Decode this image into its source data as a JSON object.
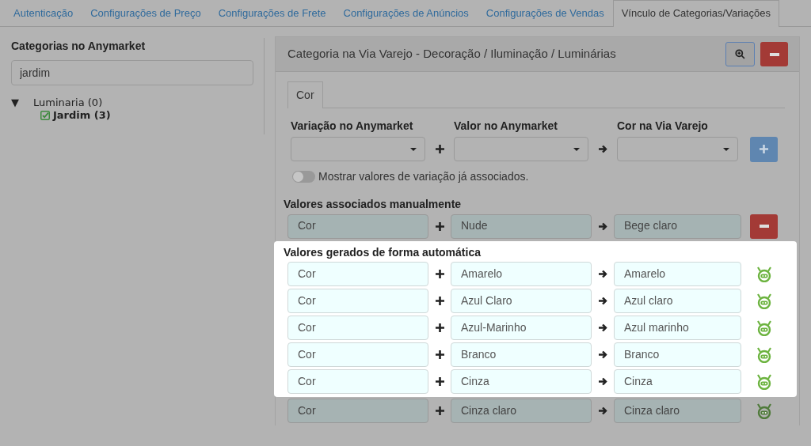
{
  "tabs": [
    {
      "label": "Autenticação",
      "selected": false
    },
    {
      "label": "Configurações de Preço",
      "selected": false
    },
    {
      "label": "Configurações de Frete",
      "selected": false
    },
    {
      "label": "Configurações de Anúncios",
      "selected": false
    },
    {
      "label": "Configurações de Vendas",
      "selected": false
    },
    {
      "label": "Vínculo de Categorias/Variações",
      "selected": true
    }
  ],
  "sidebar": {
    "title": "Categorias no Anymarket",
    "search": {
      "value": "jardim"
    },
    "tree": [
      {
        "toggle": "▼",
        "label": "Luminaria (0)",
        "expanded": true,
        "children": [
          {
            "label": "Jardim (3)",
            "checked": true
          }
        ]
      }
    ]
  },
  "panel": {
    "title": "Categoria na Via Varejo - Decoração / Iluminação / Luminárias",
    "subtabs": [
      {
        "label": "Cor",
        "selected": true
      }
    ],
    "columns": [
      "Variação no Anymarket",
      "Valor no Anymarket",
      "Cor na Via Varejo"
    ],
    "toggle": {
      "label": "Mostrar valores de variação já associados.",
      "on": false
    },
    "manual": {
      "title": "Valores associados manualmente",
      "rows": [
        {
          "variation": "Cor",
          "value": "Nude",
          "target": "Bege claro"
        }
      ]
    },
    "automatic": {
      "title": "Valores gerados de forma automática",
      "rows": [
        {
          "variation": "Cor",
          "value": "Amarelo",
          "target": "Amarelo",
          "dimmed": false
        },
        {
          "variation": "Cor",
          "value": "Azul Claro",
          "target": "Azul claro",
          "dimmed": false
        },
        {
          "variation": "Cor",
          "value": "Azul-Marinho",
          "target": "Azul marinho",
          "dimmed": false
        },
        {
          "variation": "Cor",
          "value": "Branco",
          "target": "Branco",
          "dimmed": false
        },
        {
          "variation": "Cor",
          "value": "Cinza",
          "target": "Cinza",
          "dimmed": false
        },
        {
          "variation": "Cor",
          "value": "Cinza claro",
          "target": "Cinza claro",
          "dimmed": true
        }
      ]
    }
  }
}
